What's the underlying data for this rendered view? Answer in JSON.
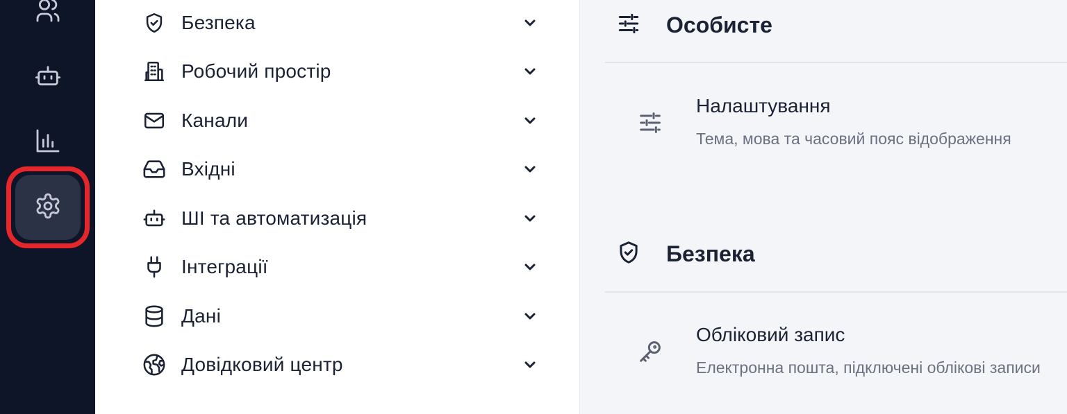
{
  "rail": {
    "items": [
      {
        "icon": "users-icon",
        "active": false
      },
      {
        "icon": "bot-icon",
        "active": false
      },
      {
        "icon": "bar-chart-icon",
        "active": false
      },
      {
        "icon": "gear-icon",
        "active": true
      }
    ],
    "highlight_color": "#e5262b"
  },
  "nav": {
    "items": [
      {
        "icon": "shield-check-icon",
        "label": "Безпека"
      },
      {
        "icon": "building-icon",
        "label": "Робочий простір"
      },
      {
        "icon": "mail-icon",
        "label": "Канали"
      },
      {
        "icon": "inbox-icon",
        "label": "Вхідні"
      },
      {
        "icon": "bot-icon",
        "label": "ШІ та автоматизація"
      },
      {
        "icon": "plug-icon",
        "label": "Інтеграції"
      },
      {
        "icon": "database-icon",
        "label": "Дані"
      },
      {
        "icon": "globe-icon",
        "label": "Довідковий центр"
      }
    ]
  },
  "content": {
    "sections": [
      {
        "icon": "sliders-icon",
        "title": "Особисте",
        "cards": [
          {
            "icon": "sliders-icon",
            "title": "Налаштування",
            "description": "Тема, мова та часовий пояс відображення"
          }
        ]
      },
      {
        "icon": "shield-check-icon",
        "title": "Безпека",
        "cards": [
          {
            "icon": "key-icon",
            "title": "Обліковий запис",
            "description": "Електронна пошта, підключені облікові записи"
          }
        ]
      }
    ]
  },
  "colors": {
    "rail_bg": "#0f1528",
    "rail_active_bg": "#2b3246",
    "text_primary": "#1b2233",
    "text_secondary": "#6b7180",
    "content_bg": "#f4f5f8"
  }
}
